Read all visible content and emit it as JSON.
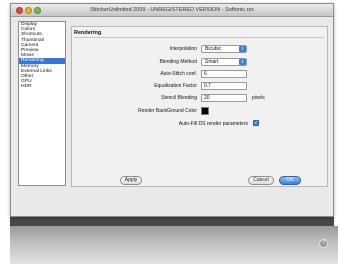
{
  "window": {
    "title": "StitcherUnlimited 2009 - UNREGISTERED VERSION - Softonic.rzs"
  },
  "sidebar": {
    "items": [
      {
        "label": "Display",
        "selected": false
      },
      {
        "label": "Colors",
        "selected": false
      },
      {
        "label": "Shortcuts",
        "selected": false
      },
      {
        "label": "Thumbnail",
        "selected": false
      },
      {
        "label": "Camera",
        "selected": false
      },
      {
        "label": "Preview",
        "selected": false
      },
      {
        "label": "Movie",
        "selected": false
      },
      {
        "label": "Rendering",
        "selected": true
      },
      {
        "label": "Memory",
        "selected": false
      },
      {
        "label": "External Links",
        "selected": false
      },
      {
        "label": "Other",
        "selected": false
      },
      {
        "label": "GPU",
        "selected": false
      },
      {
        "label": "HDR",
        "selected": false
      }
    ]
  },
  "panel": {
    "title": "Rendering",
    "interpolation": {
      "label": "Interpolation",
      "value": "Bicubic"
    },
    "blending_method": {
      "label": "Blending Method",
      "value": "Smart"
    },
    "auto_stitch": {
      "label": "Auto-Stitch coef.",
      "value": "6"
    },
    "equalization": {
      "label": "Equalization Factor",
      "value": "0.7"
    },
    "stencil": {
      "label": "Stencil Blending",
      "value": "20",
      "unit": "pixels"
    },
    "background_color": {
      "label": "Render BackGround Color",
      "color": "#000000"
    },
    "autofill": {
      "label": "Auto-Fill DS render parameters",
      "checked": true
    }
  },
  "buttons": {
    "apply": "Apply",
    "cancel": "Cancel",
    "ok": "OK"
  },
  "icons": {
    "corner": "question-icon"
  }
}
